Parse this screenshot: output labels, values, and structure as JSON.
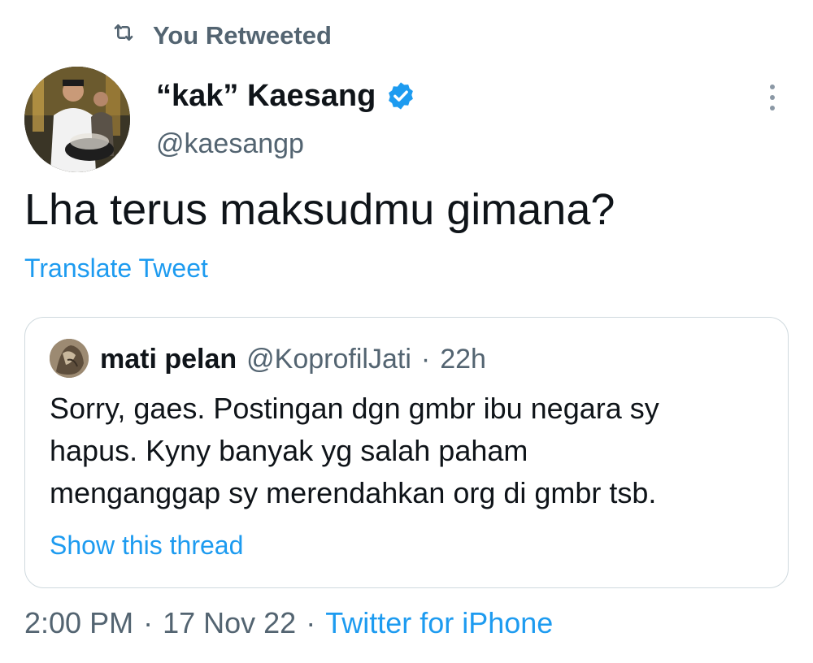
{
  "retweet": {
    "label": "You Retweeted",
    "icon": "retweet-icon"
  },
  "tweet": {
    "display_name": "“kak” Kaesang",
    "handle": "@kaesangp",
    "verified_icon": "verified-badge-icon",
    "text": "Lha terus maksudmu gimana?",
    "translate_label": "Translate Tweet",
    "more_icon": "more-vertical-icon"
  },
  "quote": {
    "display_name": "mati pelan",
    "handle": "@KoprofilJati",
    "separator": "·",
    "time": "22h",
    "lines": [
      "Sorry, gaes. Postingan dgn gmbr ibu negara sy",
      "hapus. Kyny banyak yg salah paham",
      "menganggap sy merendahkan org di gmbr tsb."
    ],
    "show_thread_label": "Show this thread"
  },
  "footer": {
    "time": "2:00 PM",
    "sep1": "·",
    "date": "17 Nov 22",
    "sep2": "·",
    "source": "Twitter for iPhone"
  },
  "colors": {
    "link": "#1d9bf0",
    "secondary_text": "#536471",
    "primary_text": "#0f1419",
    "border": "#cfd9de"
  }
}
